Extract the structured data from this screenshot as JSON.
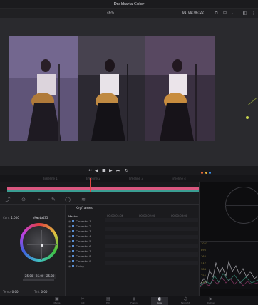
{
  "app": {
    "title": "Drakkaria Color"
  },
  "viewer_bar": {
    "zoom": "46%",
    "timecode": "01:00:06:22"
  },
  "clips": [
    {
      "name": "clip-a",
      "tint": "#6b5e86"
    },
    {
      "name": "clip-b",
      "tint": "#3e3a46"
    },
    {
      "name": "clip-c",
      "tint": "#4b3d57"
    }
  ],
  "timeline": {
    "labels": [
      "Timeline 1",
      "Timeline 2",
      "Timeline 3",
      "Timeline 4"
    ],
    "accent_colors": [
      "#d9577f",
      "#3b9e93",
      "#e04646"
    ]
  },
  "wheels": {
    "contrast_label": "Cont",
    "contrast_value": "1.000",
    "pivot_label": "Piv",
    "pivot_value": "0.435",
    "wheel_label": "Offset",
    "r": "25.00",
    "g": "25.00",
    "b": "25.00",
    "temp_label": "Temp",
    "temp_value": "0.00",
    "tint_label": "Tint",
    "tint_value": "0.00"
  },
  "layers": {
    "title": "Keyframes",
    "header": "Master",
    "rows": [
      "Corrector 1",
      "Corrector 2",
      "Corrector 3",
      "Corrector 4",
      "Corrector 5",
      "Corrector 6",
      "Corrector 7",
      "Corrector 8",
      "Corrector 9",
      "Sizing"
    ],
    "columns": [
      "00:00:01:06",
      "00:00:02:00",
      "00:00:03:00"
    ]
  },
  "scopes": {
    "wave_labels": [
      "1023",
      "896",
      "768",
      "512",
      "384",
      "256",
      "128"
    ]
  },
  "tabs": [
    {
      "label": "Media",
      "icon": "▣"
    },
    {
      "label": "Cut",
      "icon": "✂"
    },
    {
      "label": "Edit",
      "icon": "▤"
    },
    {
      "label": "Fusion",
      "icon": "◈"
    },
    {
      "label": "Color",
      "icon": "◐"
    },
    {
      "label": "Fairlight",
      "icon": "♫"
    },
    {
      "label": "Deliver",
      "icon": "▶"
    }
  ]
}
